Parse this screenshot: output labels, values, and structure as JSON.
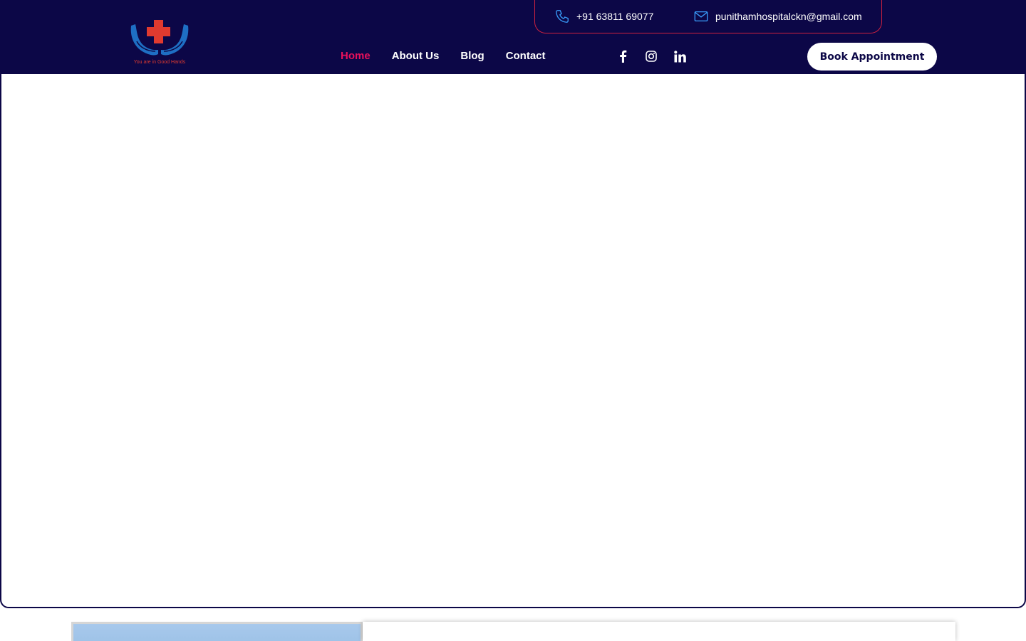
{
  "logo": {
    "tagline": "You are in Good Hands",
    "icon": "red-cross-in-blue-hands-logo"
  },
  "contact": {
    "phone": "+91 63811 69077",
    "email": "punithamhospitalckn@gmail.com",
    "phone_icon": "phone-icon",
    "email_icon": "mail-icon"
  },
  "nav": {
    "items": [
      {
        "label": "Home",
        "active": true
      },
      {
        "label": "About Us",
        "active": false
      },
      {
        "label": "Blog",
        "active": false
      },
      {
        "label": "Contact",
        "active": false
      }
    ]
  },
  "social": {
    "icons": [
      "facebook-icon",
      "instagram-icon",
      "linkedin-icon"
    ]
  },
  "cta": {
    "book_label": "Book Appointment"
  },
  "about": {
    "heading": ""
  },
  "colors": {
    "header_bg": "#0c0747",
    "active_nav": "#e8115b",
    "accent_red": "#d0213f",
    "logo_blue": "#1e6fc4",
    "logo_red": "#e03a2f",
    "icon_blue": "#3aa0ff",
    "heading_green": "#1d6b2a"
  }
}
